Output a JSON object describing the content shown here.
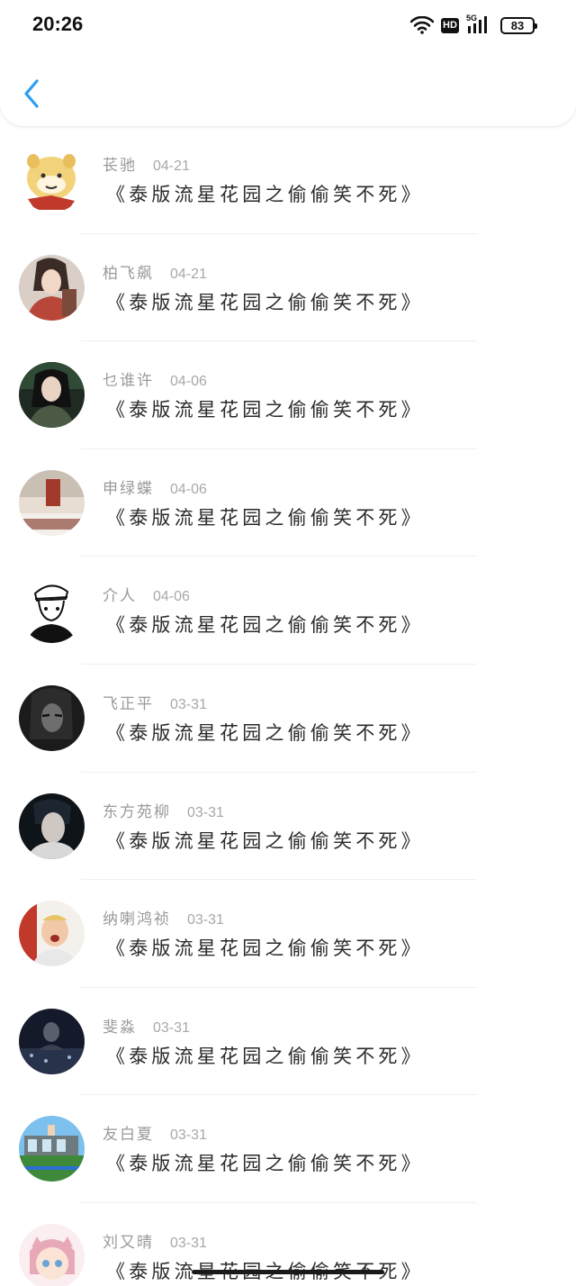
{
  "status_bar": {
    "time": "20:26",
    "network_badge": "HD",
    "network_type": "5G",
    "battery": "83"
  },
  "header": {
    "back_icon": "chevron-left-icon",
    "accent_color": "#2a9df4"
  },
  "comments": [
    {
      "username": "苌驰",
      "date": "04-21",
      "text": "《泰版流星花园之偷偷笑不死》"
    },
    {
      "username": "柏飞飙",
      "date": "04-21",
      "text": "《泰版流星花园之偷偷笑不死》"
    },
    {
      "username": "乜谁许",
      "date": "04-06",
      "text": "《泰版流星花园之偷偷笑不死》"
    },
    {
      "username": "申绿蝶",
      "date": "04-06",
      "text": "《泰版流星花园之偷偷笑不死》"
    },
    {
      "username": "介人",
      "date": "04-06",
      "text": "《泰版流星花园之偷偷笑不死》"
    },
    {
      "username": "飞正平",
      "date": "03-31",
      "text": "《泰版流星花园之偷偷笑不死》"
    },
    {
      "username": "东方苑柳",
      "date": "03-31",
      "text": "《泰版流星花园之偷偷笑不死》"
    },
    {
      "username": "纳喇鸿祯",
      "date": "03-31",
      "text": "《泰版流星花园之偷偷笑不死》"
    },
    {
      "username": "斐淼",
      "date": "03-31",
      "text": "《泰版流星花园之偷偷笑不死》"
    },
    {
      "username": "友白夏",
      "date": "03-31",
      "text": "《泰版流星花园之偷偷笑不死》"
    },
    {
      "username": "刘又晴",
      "date": "03-31",
      "text": "《泰版流星花园之偷偷笑不死》"
    }
  ]
}
